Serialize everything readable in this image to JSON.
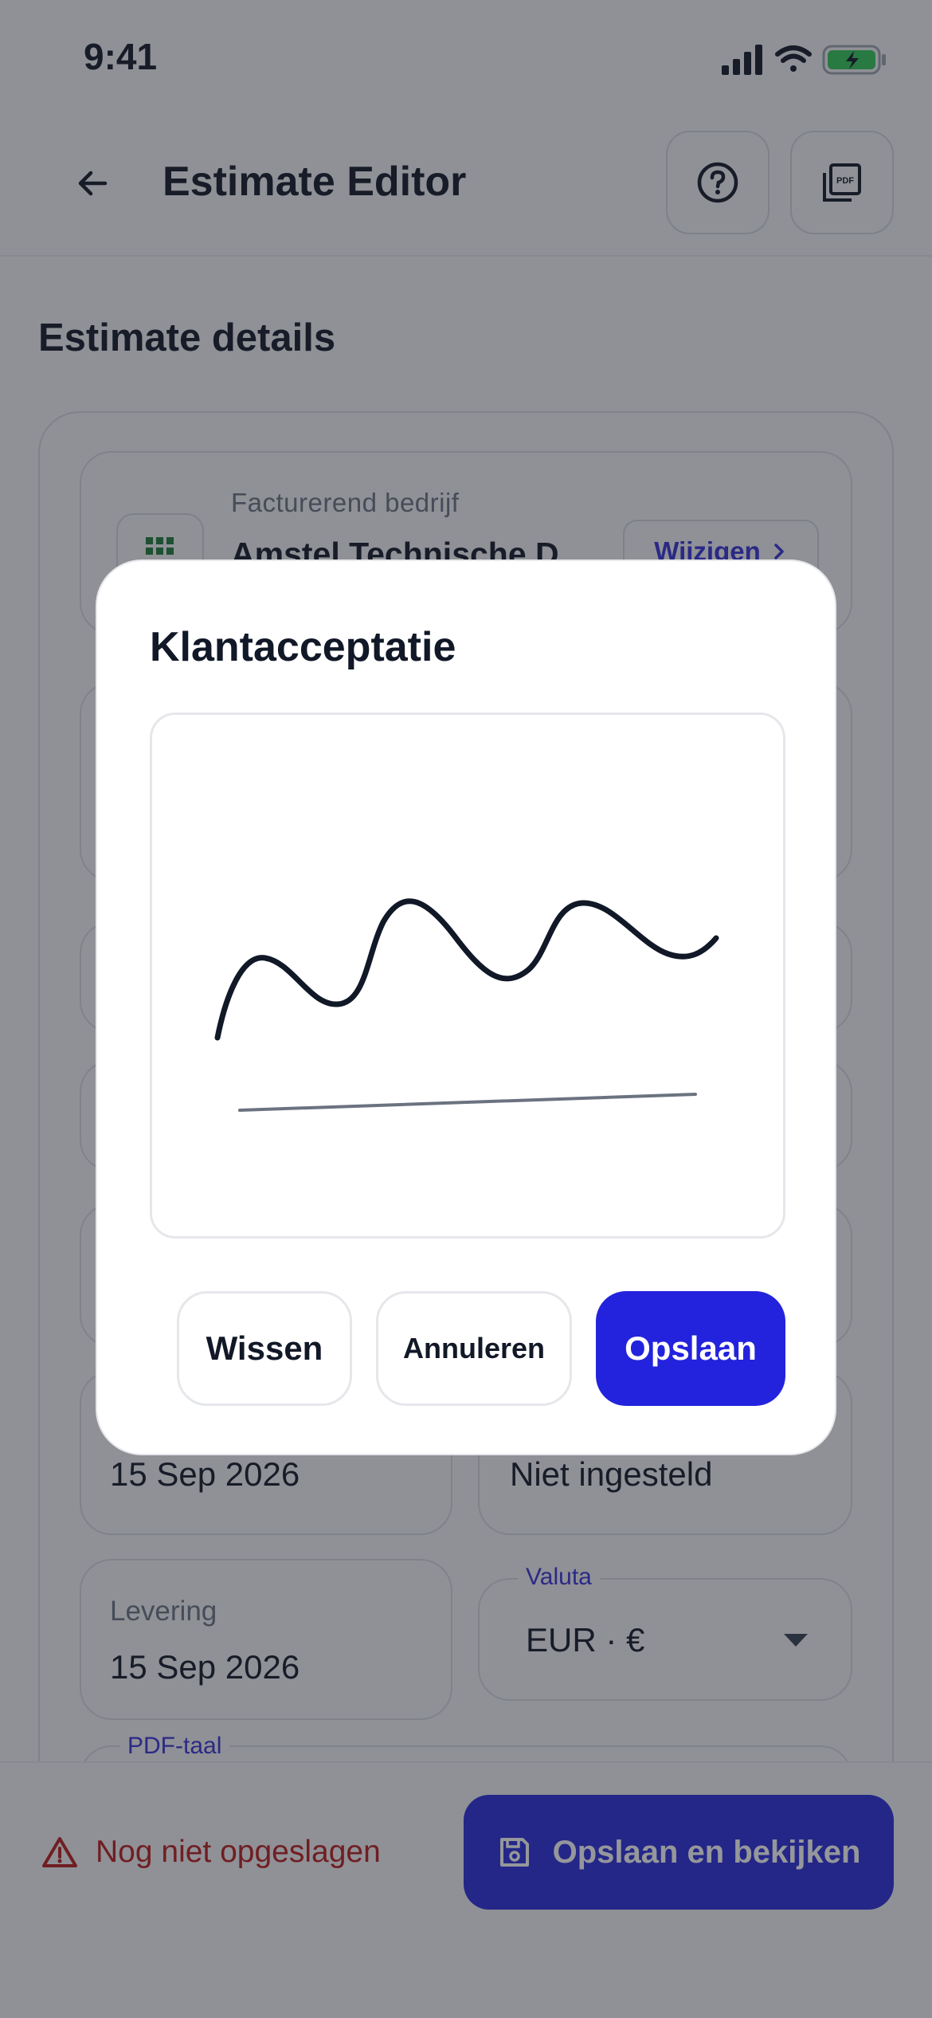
{
  "status_bar": {
    "time": "9:41"
  },
  "app_bar": {
    "title": "Estimate Editor"
  },
  "section": {
    "title": "Estimate details"
  },
  "company": {
    "label": "Facturerend bedrijf",
    "name": "Amstel Technische D",
    "change_label": "Wijzigen"
  },
  "fields": {
    "date_left_value": "15 Sep 2026",
    "date_right_value": "Niet ingesteld",
    "delivery_label": "Levering",
    "delivery_value": "15 Sep 2026",
    "currency_label": "Valuta",
    "currency_value": "EUR · €",
    "pdf_language_label": "PDF-taal"
  },
  "bottom_bar": {
    "unsaved_text": "Nog niet opgeslagen",
    "save_view_label": "Opslaan en bekijken"
  },
  "modal": {
    "title": "Klantacceptatie",
    "clear_label": "Wissen",
    "cancel_label": "Annuleren",
    "save_label": "Opslaan"
  },
  "colors": {
    "accent": "#2323dd",
    "warning": "#b91c1c",
    "link": "#3730d6",
    "logo": "#1f7a3a"
  }
}
